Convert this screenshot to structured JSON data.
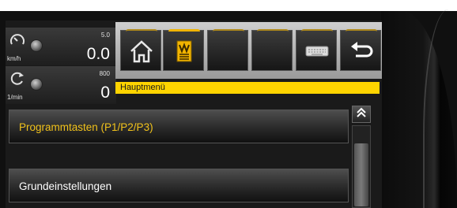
{
  "gauges": {
    "speed": {
      "unit": "km/h",
      "max": "5.0",
      "value": "0.0",
      "icon": "speedometer-icon"
    },
    "rpm": {
      "unit": "1/min",
      "max": "800",
      "value": "0",
      "icon": "rpm-icon"
    }
  },
  "toolbar": {
    "buttons": [
      {
        "icon": "home-icon",
        "active": false
      },
      {
        "icon": "menu-book-icon",
        "active": true
      },
      {
        "icon": "blank",
        "active": false
      },
      {
        "icon": "blank",
        "active": false
      },
      {
        "icon": "keyboard-icon",
        "active": false
      },
      {
        "icon": "back-arrow-icon",
        "active": false
      }
    ]
  },
  "status": {
    "title": "Hauptmenü"
  },
  "menu": {
    "items": [
      {
        "label": "Programmtasten (P1/P2/P3)",
        "highlighted": true
      },
      {
        "label": "Grundeinstellungen",
        "highlighted": false
      }
    ]
  },
  "colors": {
    "accent_yellow": "#ffd400",
    "highlight_text": "#f1c21b",
    "panel_dark": "#1a1a1a"
  }
}
